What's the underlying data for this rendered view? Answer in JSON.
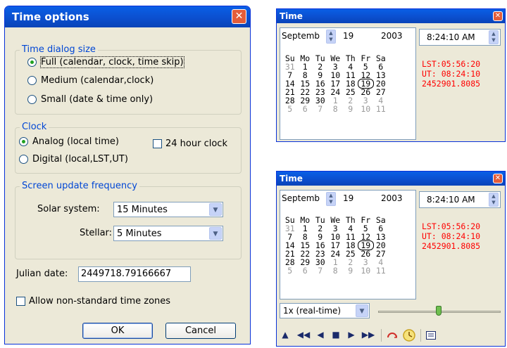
{
  "options_dialog": {
    "title": "Time options",
    "dialog_size": {
      "legend": "Time dialog size",
      "full": "Full (calendar, clock, time skip)",
      "medium": "Medium (calendar,clock)",
      "small": "Small (date & time only)"
    },
    "clock": {
      "legend": "Clock",
      "analog": "Analog (local time)",
      "digital": "Digital (local,LST,UT)",
      "hour24": "24 hour clock"
    },
    "update": {
      "legend": "Screen update frequency",
      "solar_label": "Solar system:",
      "solar_value": "15 Minutes",
      "stellar_label": "Stellar:",
      "stellar_value": "5 Minutes"
    },
    "julian_label": "Julian date:",
    "julian_value": "2449718.79166667",
    "nonstandard": "Allow non-standard time zones",
    "ok": "OK",
    "cancel": "Cancel"
  },
  "time_window": {
    "title": "Time",
    "month": "Septemb",
    "day": "19",
    "year": "2003",
    "time": "8:24:10 AM",
    "lst": "LST:05:56:20",
    "ut": "UT: 08:24:10",
    "jd": "2452901.8085",
    "weekdays": [
      "Su",
      "Mo",
      "Tu",
      "We",
      "Th",
      "Fr",
      "Sa"
    ],
    "weeks": [
      [
        "31",
        "1",
        "2",
        "3",
        "4",
        "5",
        "6"
      ],
      [
        "7",
        "8",
        "9",
        "10",
        "11",
        "12",
        "13"
      ],
      [
        "14",
        "15",
        "16",
        "17",
        "18",
        "19",
        "20"
      ],
      [
        "21",
        "22",
        "23",
        "24",
        "25",
        "26",
        "27"
      ],
      [
        "28",
        "29",
        "30",
        "1",
        "2",
        "3",
        "4"
      ],
      [
        "5",
        "6",
        "7",
        "8",
        "9",
        "10",
        "11"
      ]
    ],
    "speed": "1x (real-time)",
    "close": "x"
  },
  "icons": {
    "eject": "▲",
    "fast_rewind": "◀◀",
    "rewind": "◀",
    "stop": "■",
    "play": "▶",
    "fast_forward": "▶▶"
  },
  "colors": {
    "accent_red": "#ff0000",
    "title_blue": "#0a5fe6"
  }
}
